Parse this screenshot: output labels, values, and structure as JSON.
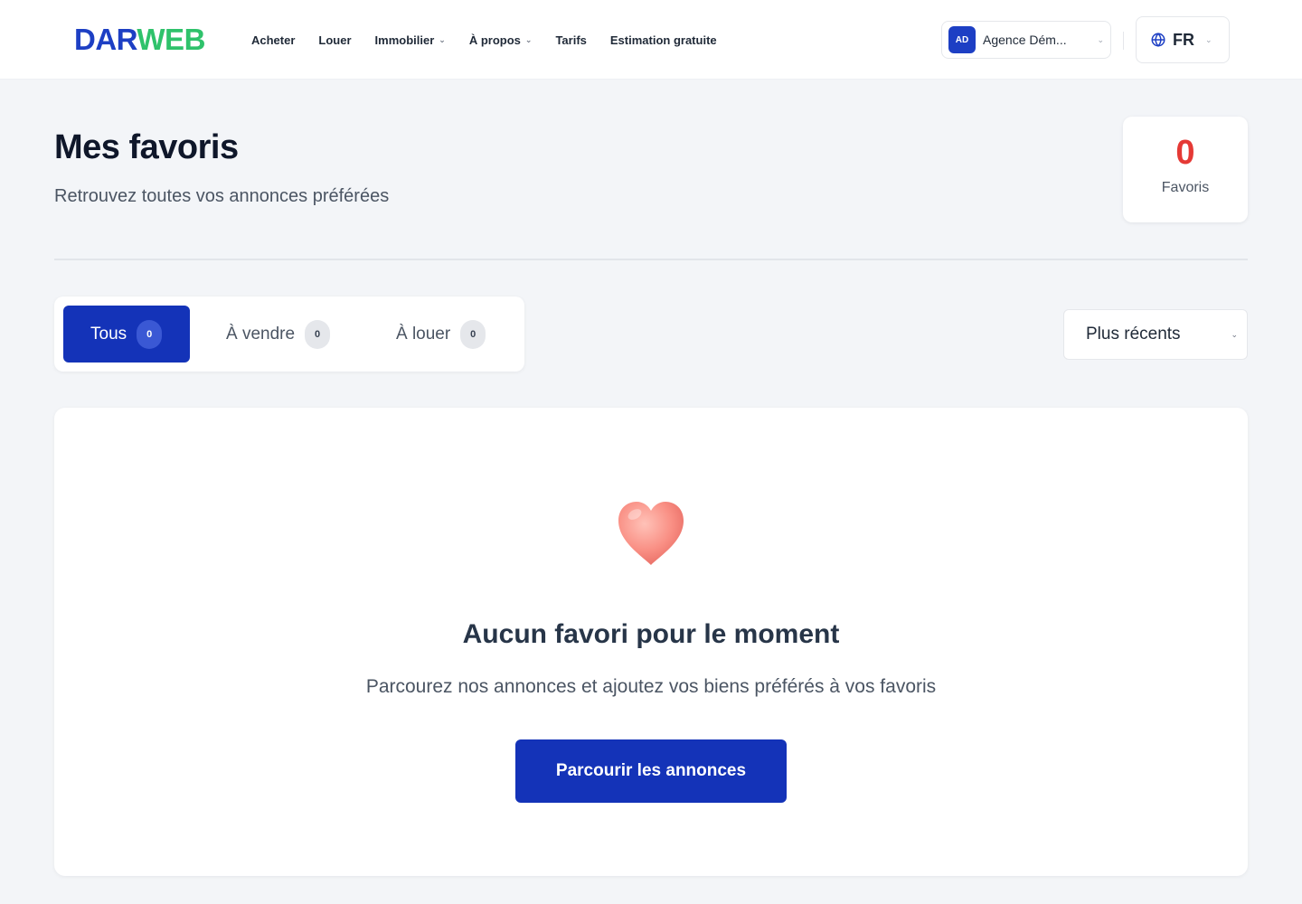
{
  "header": {
    "logo": {
      "part1": "DAR",
      "part2": "WEB"
    },
    "nav": [
      {
        "label": "Acheter",
        "has_dropdown": false
      },
      {
        "label": "Louer",
        "has_dropdown": false
      },
      {
        "label": "Immobilier",
        "has_dropdown": true
      },
      {
        "label": "À propos",
        "has_dropdown": true
      },
      {
        "label": "Tarifs",
        "has_dropdown": false
      },
      {
        "label": "Estimation gratuite",
        "has_dropdown": false
      }
    ],
    "account": {
      "initials": "AD",
      "name": "Agence Dém..."
    },
    "language": {
      "code": "FR",
      "icon": "globe-icon"
    }
  },
  "page": {
    "title": "Mes favoris",
    "subtitle": "Retrouvez toutes vos annonces préférées",
    "favorites_count": {
      "value": "0",
      "label": "Favoris"
    }
  },
  "tabs": [
    {
      "label": "Tous",
      "count": "0",
      "active": true
    },
    {
      "label": "À vendre",
      "count": "0",
      "active": false
    },
    {
      "label": "À louer",
      "count": "0",
      "active": false
    }
  ],
  "sort": {
    "selected": "Plus récents"
  },
  "empty_state": {
    "icon": "heart-icon",
    "title": "Aucun favori pour le moment",
    "text": "Parcourez nos annonces et ajoutez vos biens préférés à vos favoris",
    "button": "Parcourir les annonces"
  },
  "colors": {
    "primary": "#1433b8",
    "logo_blue": "#1d3fc4",
    "logo_green": "#2fc26b",
    "count_red": "#e53935",
    "background": "#f3f5f8"
  }
}
